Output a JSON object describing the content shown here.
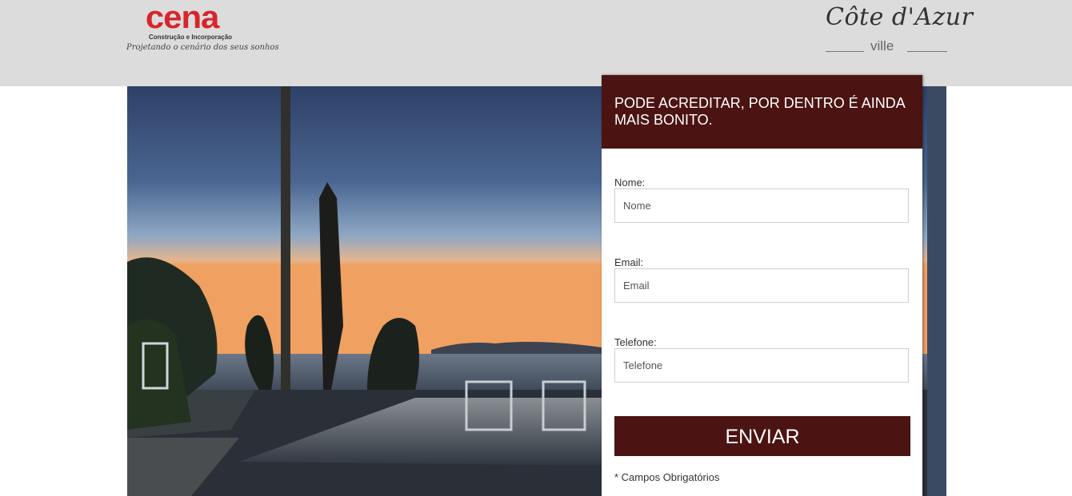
{
  "header": {
    "cena_logo": {
      "brand": "cena",
      "subtitle": "Construção e Incorporação",
      "tagline": "Projetando o cenário dos seus sonhos"
    },
    "cote_logo": {
      "name": "Côte d'Azur",
      "sub": "ville"
    }
  },
  "form": {
    "title": "PODE ACREDITAR, POR DENTRO É AINDA MAIS BONITO.",
    "fields": [
      {
        "label": "Nome:",
        "placeholder": "Nome",
        "value": ""
      },
      {
        "label": "Email:",
        "placeholder": "Email",
        "value": ""
      },
      {
        "label": "Telefone:",
        "placeholder": "Telefone",
        "value": ""
      }
    ],
    "submit_label": "ENVIAR",
    "required_note": "* Campos Obrigatórios"
  },
  "colors": {
    "header_bg": "#dcdcdc",
    "form_accent": "#4b1412",
    "cena_red": "#d6262b"
  }
}
